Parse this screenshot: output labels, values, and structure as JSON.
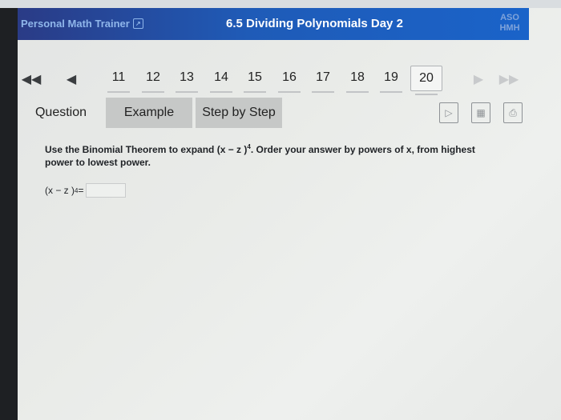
{
  "header": {
    "app_name": "Personal Math Trainer",
    "title": "6.5 Dividing Polynomials Day 2",
    "logo_top": "ASO",
    "logo_bottom": "HMH"
  },
  "nav": {
    "first_icon": "double-left-arrow-icon",
    "prev_icon": "left-arrow-icon",
    "pages": [
      "11",
      "12",
      "13",
      "14",
      "15",
      "16",
      "17",
      "18",
      "19",
      "20"
    ],
    "active_page": "20",
    "next_icon": "right-arrow-icon",
    "last_icon": "double-right-arrow-icon"
  },
  "tabs": {
    "question": "Question",
    "example": "Example",
    "step_by_step": "Step by Step"
  },
  "tools": [
    "video-icon",
    "book-icon",
    "print-icon"
  ],
  "content": {
    "question_part1": "Use the Binomial Theorem to expand (x  − z )",
    "question_exp": "4",
    "question_part2": ". Order your answer by powers of x, from highest power to lowest power.",
    "answer_lhs": "(x  − z )",
    "answer_exp": "4",
    "answer_eq": " ="
  }
}
